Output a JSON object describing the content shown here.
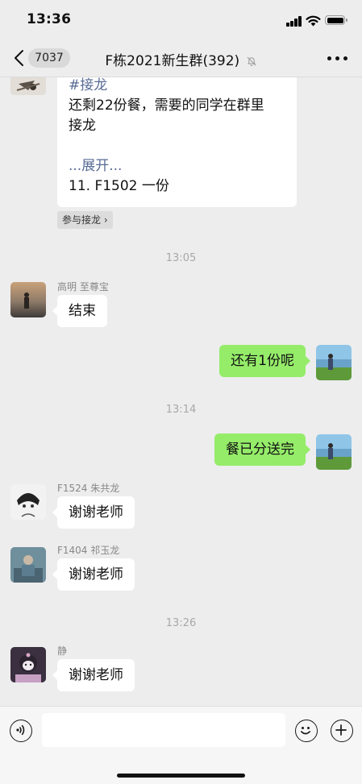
{
  "status_bar": {
    "time": "13:36"
  },
  "header": {
    "back_count": "7037",
    "title": "F栋2021新生群(392)",
    "icons": [
      "chevron-left-icon",
      "bell-muted-icon",
      "more-dots-icon"
    ]
  },
  "messages": {
    "solitaire": {
      "tag": "#接龙",
      "line1": "还剩22份餐，需要的同学在群里",
      "line2": "接龙",
      "expand": "...展开...",
      "entry": "11. F1502 一份",
      "join_button": "参与接龙 ›"
    },
    "time1": "13:05",
    "msg1": {
      "sender": "高明 至尊宝",
      "text": "结束"
    },
    "msg2": {
      "text": "还有1份呢"
    },
    "time2": "13:14",
    "msg3": {
      "text": "餐已分送完"
    },
    "msg4": {
      "sender": "F1524 朱共龙",
      "text": "谢谢老师"
    },
    "msg5": {
      "sender": "F1404 祁玉龙",
      "text": "谢谢老师"
    },
    "time3": "13:26",
    "msg6": {
      "sender": "静",
      "text": "谢谢老师"
    }
  },
  "input_bar": {
    "icons": [
      "voice-icon",
      "emoji-icon",
      "plus-icon"
    ],
    "value": ""
  },
  "colors": {
    "background": "#ededed",
    "my_bubble": "#95ec69",
    "link": "#576b95"
  }
}
